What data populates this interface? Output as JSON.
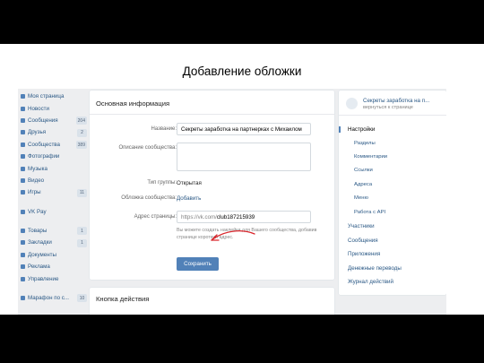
{
  "slide": {
    "title": "Добавление обложки"
  },
  "left_nav": {
    "items": [
      {
        "label": "Моя страница",
        "count": ""
      },
      {
        "label": "Новости",
        "count": ""
      },
      {
        "label": "Сообщения",
        "count": "204"
      },
      {
        "label": "Друзья",
        "count": "2"
      },
      {
        "label": "Сообщества",
        "count": "389"
      },
      {
        "label": "Фотографии",
        "count": ""
      },
      {
        "label": "Музыка",
        "count": ""
      },
      {
        "label": "Видео",
        "count": ""
      },
      {
        "label": "Игры",
        "count": "11"
      }
    ],
    "vkpay": "VK Pay",
    "items2": [
      {
        "label": "Товары",
        "count": "1"
      },
      {
        "label": "Закладки",
        "count": "1"
      },
      {
        "label": "Документы",
        "count": ""
      },
      {
        "label": "Реклама",
        "count": ""
      },
      {
        "label": "Управление",
        "count": ""
      }
    ],
    "marathon": {
      "label": "Марафон по с...",
      "count": "10"
    }
  },
  "main": {
    "title": "Основная информация",
    "name_label": "Название:",
    "name_value": "Секреты заработка на партнерках с Михаилом",
    "description_label": "Описание сообщества:",
    "group_type_label": "Тип группы:",
    "group_type_value": "Открытая",
    "cover_label": "Обложка сообщества:",
    "cover_link": "Добавить",
    "address_label": "Адрес страницы:",
    "address_prefix": "https://vk.com/",
    "address_value": "club187215939",
    "address_hint": "Вы можете создать наклейки для Вашего сообщества, добавив странице короткий адрес.",
    "save_button": "Сохранить",
    "section2_title": "Кнопка действия"
  },
  "right_menu": {
    "community_name": "Секреты заработка на п...",
    "back_link": "вернуться к странице",
    "items": [
      {
        "label": "Настройки",
        "active": true,
        "sub": false
      },
      {
        "label": "Разделы",
        "active": false,
        "sub": true
      },
      {
        "label": "Комментарии",
        "active": false,
        "sub": true
      },
      {
        "label": "Ссылки",
        "active": false,
        "sub": true
      },
      {
        "label": "Адреса",
        "active": false,
        "sub": true
      },
      {
        "label": "Меню",
        "active": false,
        "sub": true
      },
      {
        "label": "Работа с API",
        "active": false,
        "sub": true
      },
      {
        "label": "Участники",
        "active": false,
        "sub": false
      },
      {
        "label": "Сообщения",
        "active": false,
        "sub": false
      },
      {
        "label": "Приложения",
        "active": false,
        "sub": false
      },
      {
        "label": "Денежные переводы",
        "active": false,
        "sub": false
      },
      {
        "label": "Журнал действий",
        "active": false,
        "sub": false
      }
    ]
  },
  "annotation": {
    "arrow_color": "#d9262c",
    "icon": "hand-drawn-arrow-icon"
  },
  "colors": {
    "accent": "#5181b8",
    "link": "#2a5885",
    "background": "#edeef0"
  }
}
